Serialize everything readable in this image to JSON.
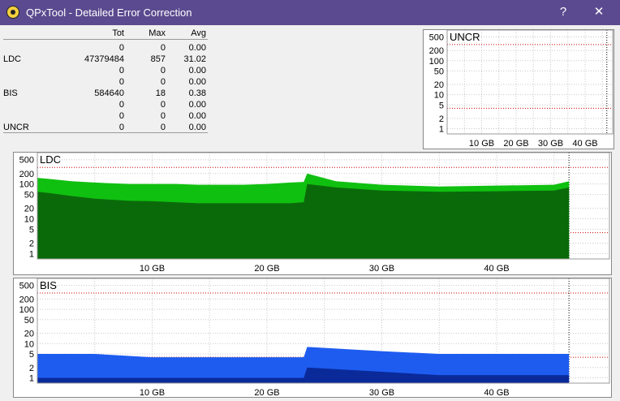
{
  "window": {
    "title": "QPxTool - Detailed Error Correction",
    "help_label": "?",
    "close_label": "✕",
    "icon": "qpxtool-app-icon"
  },
  "stats": {
    "headers": [
      "Tot",
      "Max",
      "Avg"
    ],
    "rows": [
      {
        "label": "",
        "tot": "0",
        "max": "0",
        "avg": "0.00"
      },
      {
        "label": "LDC",
        "tot": "47379484",
        "max": "857",
        "avg": "31.02"
      },
      {
        "label": "",
        "tot": "0",
        "max": "0",
        "avg": "0.00"
      },
      {
        "label": "",
        "tot": "0",
        "max": "0",
        "avg": "0.00"
      },
      {
        "label": "BIS",
        "tot": "584640",
        "max": "18",
        "avg": "0.38"
      },
      {
        "label": "",
        "tot": "0",
        "max": "0",
        "avg": "0.00"
      },
      {
        "label": "",
        "tot": "0",
        "max": "0",
        "avg": "0.00"
      },
      {
        "label": "UNCR",
        "tot": "0",
        "max": "0",
        "avg": "0.00"
      }
    ]
  },
  "colors": {
    "titlebar": "#5b4a8f",
    "ldc_light": "#10c010",
    "ldc_dark": "#0a6a0a",
    "bis_light": "#1e5cf0",
    "bis_dark": "#0a2a9a",
    "threshold": "#cc0000"
  },
  "chart_data": [
    {
      "type": "area",
      "title": "UNCR",
      "y_ticks": [
        "500",
        "200",
        "100",
        "50",
        "20",
        "10",
        "5",
        "2",
        "1"
      ],
      "x_ticks": [
        "10 GB",
        "20 GB",
        "30 GB",
        "40 GB"
      ],
      "x_range": [
        0,
        47
      ],
      "y_scale": "log",
      "series": []
    },
    {
      "type": "area",
      "title": "LDC",
      "y_ticks": [
        "500",
        "200",
        "100",
        "50",
        "20",
        "10",
        "5",
        "2",
        "1"
      ],
      "x_ticks": [
        "10 GB",
        "20 GB",
        "30 GB",
        "40 GB"
      ],
      "x_range": [
        0,
        50
      ],
      "y_scale": "log",
      "series": [
        {
          "x": [
            0,
            1,
            3,
            5,
            8,
            10,
            12,
            14,
            16,
            18,
            20,
            22,
            23.2,
            23.5,
            26,
            30,
            35,
            40,
            45,
            46.3
          ],
          "y": [
            150,
            140,
            120,
            110,
            100,
            100,
            100,
            95,
            95,
            95,
            100,
            110,
            115,
            200,
            120,
            95,
            85,
            90,
            95,
            120
          ]
        },
        {
          "x": [
            0,
            1,
            3,
            5,
            8,
            10,
            12,
            14,
            16,
            18,
            20,
            22,
            23.2,
            23.5,
            26,
            30,
            35,
            40,
            45,
            46.3
          ],
          "y": [
            60,
            55,
            45,
            38,
            33,
            32,
            30,
            28,
            28,
            28,
            28,
            28,
            30,
            100,
            80,
            65,
            60,
            62,
            65,
            80
          ]
        }
      ]
    },
    {
      "type": "area",
      "title": "BIS",
      "y_ticks": [
        "500",
        "200",
        "100",
        "50",
        "20",
        "10",
        "5",
        "2",
        "1"
      ],
      "x_ticks": [
        "10 GB",
        "20 GB",
        "30 GB",
        "40 GB"
      ],
      "x_range": [
        0,
        50
      ],
      "y_scale": "log",
      "series": [
        {
          "x": [
            0,
            5,
            10,
            15,
            20,
            23.2,
            23.5,
            30,
            35,
            40,
            46.3
          ],
          "y": [
            5,
            5,
            4,
            4,
            4,
            4,
            8,
            6,
            5,
            5,
            5
          ]
        },
        {
          "x": [
            0,
            5,
            10,
            15,
            20,
            23.2,
            23.5,
            30,
            35,
            40,
            46.3
          ],
          "y": [
            1,
            1,
            1,
            1,
            1,
            1,
            2,
            1.5,
            1.2,
            1.2,
            1.2
          ]
        }
      ]
    }
  ]
}
